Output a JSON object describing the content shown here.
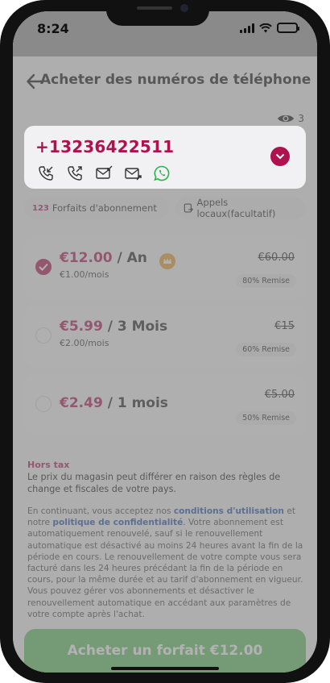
{
  "status_bar": {
    "time": "8:24"
  },
  "header": {
    "title": "Acheter des numéros de téléphone",
    "viewers": "3"
  },
  "selected_number": {
    "number": "+13236422511",
    "features": [
      "incoming-call-icon",
      "outgoing-call-icon",
      "sms-receive-icon",
      "sms-send-icon",
      "whatsapp-icon"
    ]
  },
  "tabs": [
    {
      "icon": "123",
      "label": "Forfaits d'abonnement"
    },
    {
      "icon": "local-call-icon",
      "label": "Appels locaux(facultatif)"
    }
  ],
  "plans": [
    {
      "price": "€12.00",
      "period": " / An",
      "per_month": "€1.00/mois",
      "old_price": "€60.00",
      "discount": "80% Remise",
      "selected": true
    },
    {
      "price": "€5.99",
      "period": " / 3 Mois",
      "per_month": "€2.00/mois",
      "old_price": "€15",
      "discount": "60% Remise",
      "selected": false
    },
    {
      "price": "€2.49",
      "period": " / 1 mois",
      "per_month": "",
      "old_price": "€5.00",
      "discount": "50% Remise",
      "selected": false
    }
  ],
  "notice": {
    "title": "Hors tax",
    "body": "Le prix du magasin peut différer en raison des règles de change et fiscales de votre pays."
  },
  "legal": {
    "part1": "En continuant, vous acceptez nos ",
    "terms_link": "conditions d'utilisation",
    "part2": " et notre ",
    "privacy_link": "politique de confidentialité",
    "part3": ". Votre abonnement est automatiquement renouvelé, sauf si le renouvellement automatique est désactivé au moins 24 heures avant la fin de la période en cours. Le renouvellement de votre compte vous sera facturé dans les 24 heures précédant la fin de la période en cours, pour la même durée et au tarif d'abonnement en vigueur. Vous pouvez gérer vos abonnements et désactiver le renouvellement automatique en accédant aux paramètres de votre compte après l'achat."
  },
  "cta": {
    "label": "Acheter un forfait €12.00"
  },
  "colors": {
    "accent": "#b01250",
    "cta": "#5cbf63",
    "link": "#1f4fa8"
  }
}
